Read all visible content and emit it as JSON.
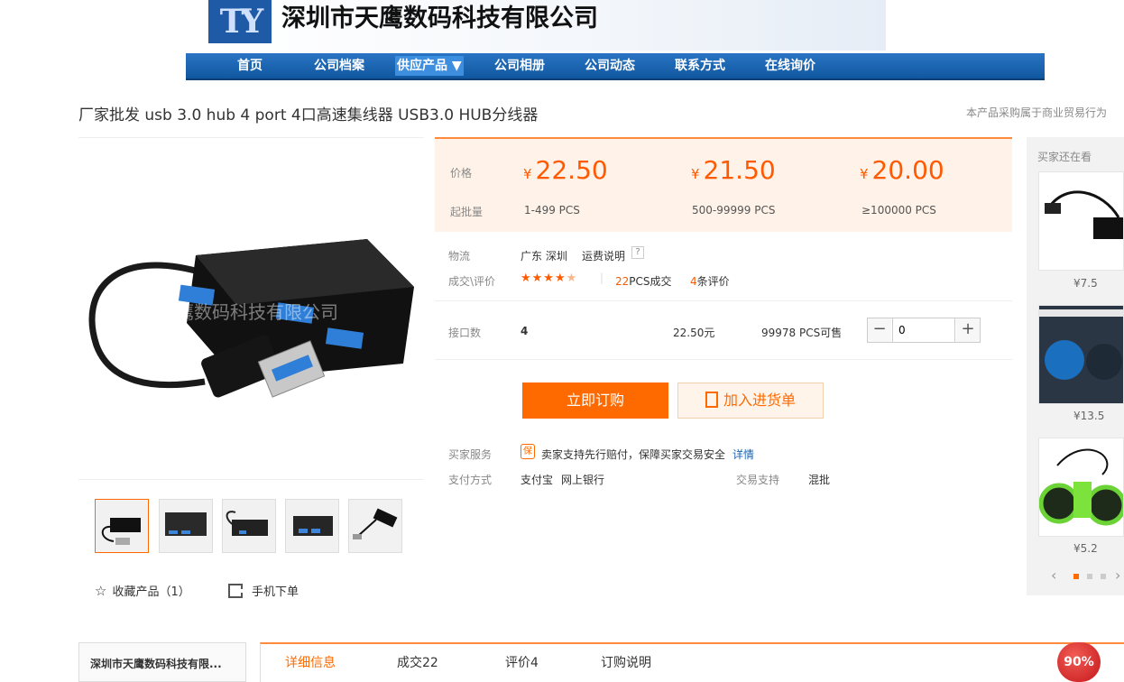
{
  "header": {
    "company_name": "深圳市天鹰数码科技有限公司",
    "logo_text": "TY"
  },
  "nav": {
    "items": [
      "首页",
      "公司档案",
      "供应产品 ▼",
      "公司相册",
      "公司动态",
      "联系方式",
      "在线询价"
    ],
    "active_index": 2
  },
  "product": {
    "title": "厂家批发 usb 3.0 hub 4 port 4口高速集线器 USB3.0 HUB分线器",
    "title_note": "本产品采购属于商业贸易行为",
    "image_watermark": "深圳市天鹰数码科技有限公司"
  },
  "price_block": {
    "price_label": "价格",
    "moq_label": "起批量",
    "currency": "¥",
    "tiers": [
      {
        "price": "22.50",
        "qty": "1-499  PCS"
      },
      {
        "price": "21.50",
        "qty": "500-99999  PCS"
      },
      {
        "price": "20.00",
        "qty": "≥100000  PCS"
      }
    ]
  },
  "logistics": {
    "label": "物流",
    "location": "广东 深圳",
    "shipping_link": "运费说明",
    "help_icon": "?"
  },
  "deals": {
    "label": "成交\\评价",
    "stars": 4.5,
    "count": "22",
    "count_suffix": "PCS成交",
    "reviews": "4",
    "reviews_suffix": "条评价"
  },
  "spec": {
    "label": "接口数",
    "value": "4",
    "unit_price": "22.50元",
    "stock": "99978 PCS可售",
    "quantity": "0",
    "minus": "−",
    "plus": "+"
  },
  "actions": {
    "buy": "立即订购",
    "cart": "加入进货单"
  },
  "service": {
    "label": "买家服务",
    "badge": "保",
    "text": "卖家支持先行赔付，保障买家交易安全",
    "link": "详情"
  },
  "payment": {
    "label": "支付方式",
    "methods": [
      "支付宝",
      "网上银行"
    ],
    "trade_label": "交易支持",
    "trade_value": "混批"
  },
  "gallery": {
    "favorite": "收藏产品（1）",
    "mobile_order": "手机下单",
    "thumb_count": 5
  },
  "sidebar": {
    "title": "买家还在看",
    "items": [
      {
        "price": "¥7.5"
      },
      {
        "price": "¥13.5"
      },
      {
        "price": "¥5.2"
      }
    ]
  },
  "bottom": {
    "shop_name": "深圳市天鹰数码科技有限...",
    "tabs": [
      "详细信息",
      "成交22",
      "评价4",
      "订购说明"
    ],
    "percent": "90%"
  },
  "colors": {
    "accent": "#ff6a00",
    "nav": "#1a64b3",
    "price_bg": "#fff2e8"
  }
}
